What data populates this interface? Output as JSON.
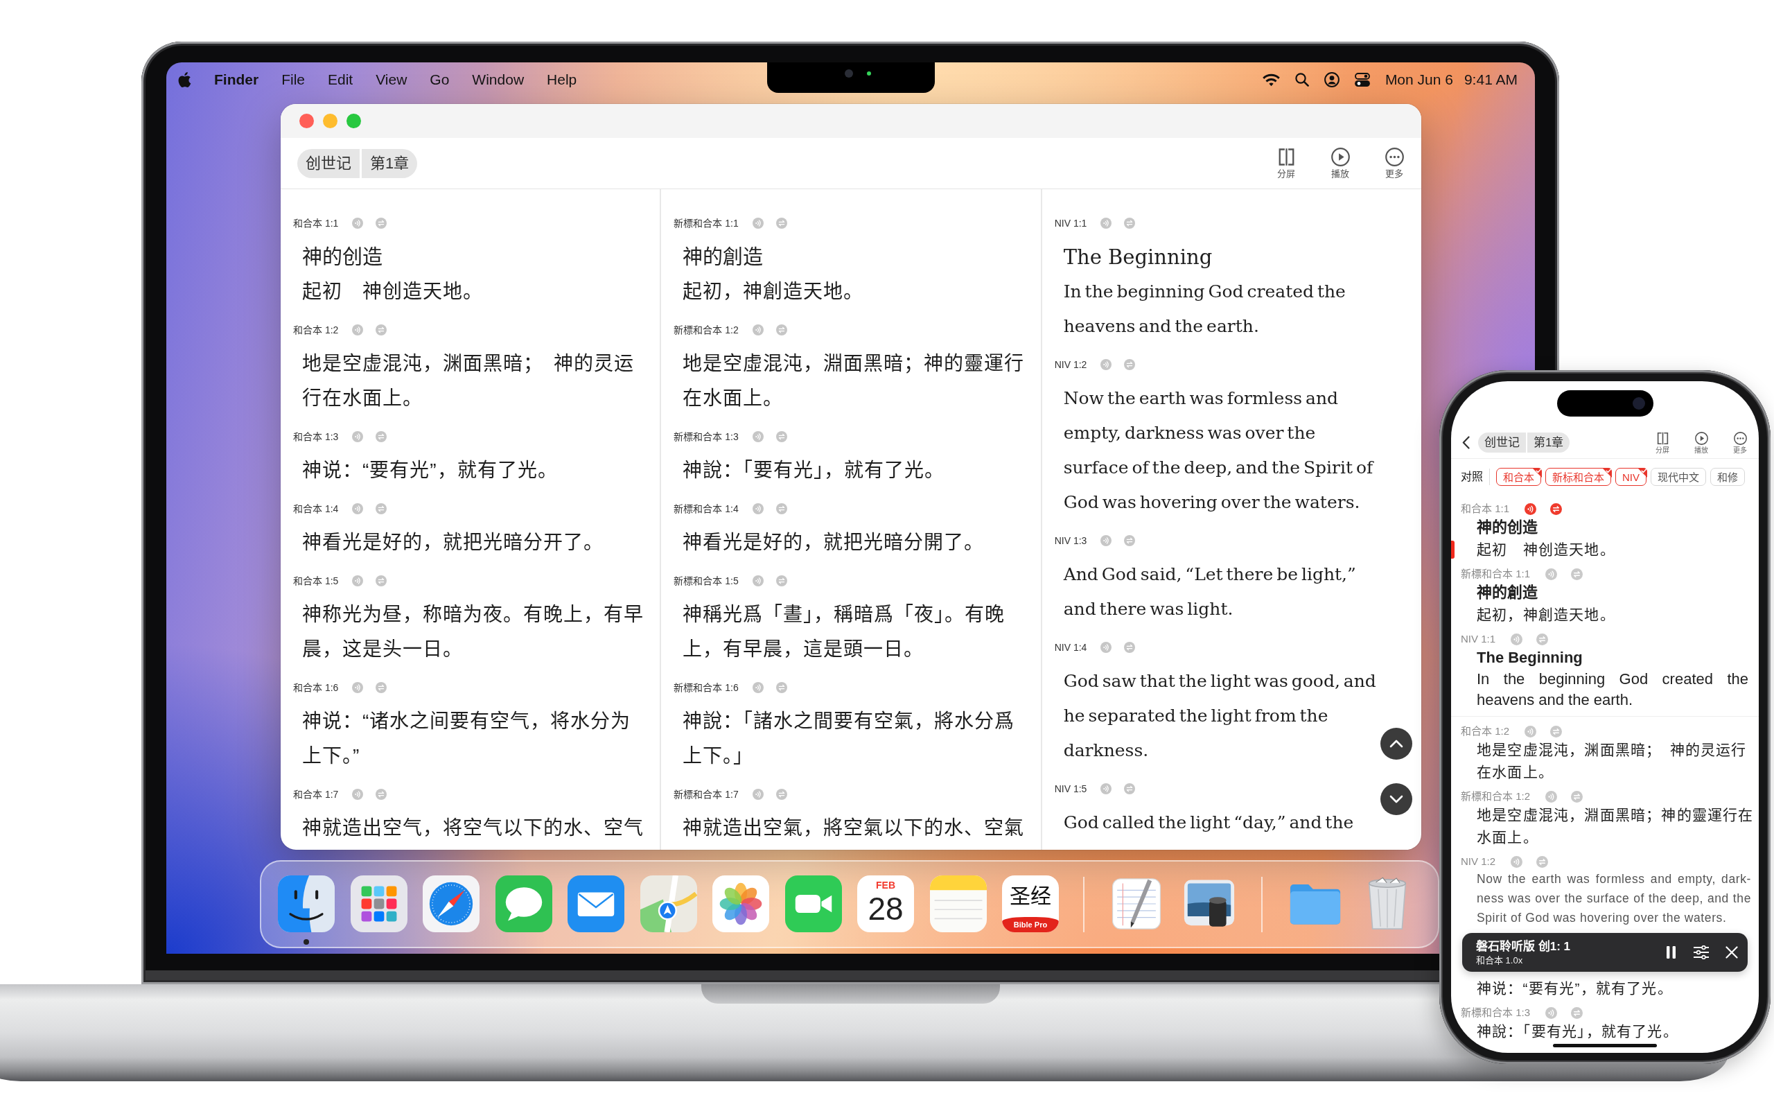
{
  "menu_bar": {
    "app_name": "Finder",
    "menus": [
      "File",
      "Edit",
      "View",
      "Go",
      "Window",
      "Help"
    ],
    "date": "Mon Jun 6",
    "time": "9:41 AM"
  },
  "mac_window": {
    "breadcrumb": [
      "创世记",
      "第1章"
    ],
    "toolbar_buttons": [
      {
        "kind": "split",
        "label": "分屏"
      },
      {
        "kind": "play",
        "label": "播放"
      },
      {
        "kind": "more",
        "label": "更多"
      }
    ],
    "columns": [
      {
        "kind": "chinese",
        "verses": [
          {
            "label": "和合本 1:1",
            "heading": "神的创造",
            "text": "起初　神创造天地。"
          },
          {
            "label": "和合本 1:2",
            "text": "地是空虚混沌，渊面黑暗；　神的灵运行在水面上。"
          },
          {
            "label": "和合本 1:3",
            "text": "神说：“要有光”，就有了光。"
          },
          {
            "label": "和合本 1:4",
            "text": "神看光是好的，就把光暗分开了。"
          },
          {
            "label": "和合本 1:5",
            "text": "神称光为昼，称暗为夜。有晚上，有早晨，这是头一日。"
          },
          {
            "label": "和合本 1:6",
            "text": "神说：“诸水之间要有空气，将水分为上下。”"
          },
          {
            "label": "和合本 1:7",
            "text": "神就造出空气，将空气以下的水、空气"
          }
        ]
      },
      {
        "kind": "chinese",
        "verses": [
          {
            "label": "新標和合本 1:1",
            "heading": "神的創造",
            "text": "起初，神創造天地。"
          },
          {
            "label": "新標和合本 1:2",
            "text": "地是空虛混沌，淵面黑暗；神的靈運行在水面上。"
          },
          {
            "label": "新標和合本 1:3",
            "text": "神說：「要有光」，就有了光。"
          },
          {
            "label": "新標和合本 1:4",
            "text": "神看光是好的，就把光暗分開了。"
          },
          {
            "label": "新標和合本 1:5",
            "text": "神稱光爲「晝」，稱暗爲「夜」。有晚上，有早晨，這是頭一日。"
          },
          {
            "label": "新標和合本 1:6",
            "text": "神說：「諸水之間要有空氣，將水分爲上下。」"
          },
          {
            "label": "新標和合本 1:7",
            "text": "神就造出空氣，將空氣以下的水、空氣"
          }
        ]
      },
      {
        "kind": "english",
        "verses": [
          {
            "label": "NIV 1:1",
            "heading": "The Beginning",
            "text": "In the beginning God created the heavens and the earth."
          },
          {
            "label": "NIV 1:2",
            "text": "Now the earth was formless and empty, darkness was over the surface of the deep, and the Spirit of God was hovering over the waters."
          },
          {
            "label": "NIV 1:3",
            "text": "And God said, “Let there be light,” and there was light."
          },
          {
            "label": "NIV 1:4",
            "text": "God saw that the light was good, and he separated the light from the darkness."
          },
          {
            "label": "NIV 1:5",
            "text": "God called the light “day,” and the"
          }
        ]
      }
    ]
  },
  "dock": {
    "sections": [
      [
        {
          "kind": "face",
          "running": true
        },
        {
          "kind": "app-grid",
          "running": false
        },
        {
          "kind": "compass",
          "running": false
        },
        {
          "kind": "chat",
          "running": false
        },
        {
          "kind": "mail",
          "running": false
        },
        {
          "kind": "map",
          "running": false
        },
        {
          "kind": "photos",
          "running": false
        },
        {
          "kind": "video",
          "running": false
        },
        {
          "kind": "calendar",
          "month": "FEB",
          "day": "28",
          "running": false
        },
        {
          "kind": "notes",
          "running": false
        },
        {
          "kind": "bible",
          "title": "圣经",
          "caption": "Bible Pro",
          "running": false
        }
      ],
      [
        {
          "kind": "text-editor",
          "running": false
        },
        {
          "kind": "photo-viewer",
          "running": false
        }
      ],
      [
        {
          "kind": "folder",
          "running": false
        },
        {
          "kind": "trash",
          "running": false
        }
      ]
    ]
  },
  "phone": {
    "breadcrumb": [
      "创世记",
      "第1章"
    ],
    "toolbar_buttons": [
      {
        "kind": "split",
        "label": "分屏"
      },
      {
        "kind": "play",
        "label": "播放"
      },
      {
        "kind": "more",
        "label": "更多"
      }
    ],
    "compare_label": "对照",
    "versions": [
      {
        "label": "和合本",
        "selected": true
      },
      {
        "label": "新标和合本",
        "selected": true
      },
      {
        "label": "NIV",
        "selected": true
      },
      {
        "label": "现代中文",
        "selected": false
      },
      {
        "label": "和修",
        "selected": false
      }
    ],
    "verse_groups": [
      [
        {
          "kind": "chinese",
          "label": "和合本 1:1",
          "active": true,
          "heading": "神的创造",
          "text": "起初　神创造天地。"
        },
        {
          "kind": "chinese",
          "label": "新標和合本 1:1",
          "active": false,
          "heading": "神的創造",
          "text": "起初，神創造天地。"
        },
        {
          "kind": "english",
          "label": "NIV 1:1",
          "active": false,
          "heading": "The Beginning",
          "text": "In the beginning God created the heavens and the earth."
        }
      ],
      [
        {
          "kind": "chinese",
          "label": "和合本 1:2",
          "active": false,
          "text": "地是空虚混沌，渊面黑暗；　神的灵运行在水面上。"
        },
        {
          "kind": "chinese",
          "label": "新標和合本 1:2",
          "active": false,
          "text": "地是空虛混沌，淵面黑暗；神的靈運行在水面上。"
        },
        {
          "kind": "compact",
          "label": "NIV 1:2",
          "active": false,
          "text": "Now the earth was formless and empty, dark-ness was over the surface of the deep, and the Spirit of God was hovering over the waters."
        }
      ],
      [
        {
          "kind": "chinese",
          "active": false,
          "text": "神说：“要有光”，就有了光。"
        },
        {
          "kind": "chinese",
          "label": "新標和合本 1:3",
          "active": false,
          "text": "神說：「要有光」，就有了光。"
        }
      ]
    ],
    "player": {
      "title": "磐石聆听版 创1: 1",
      "subtitle": "和合本 1.0x"
    }
  }
}
